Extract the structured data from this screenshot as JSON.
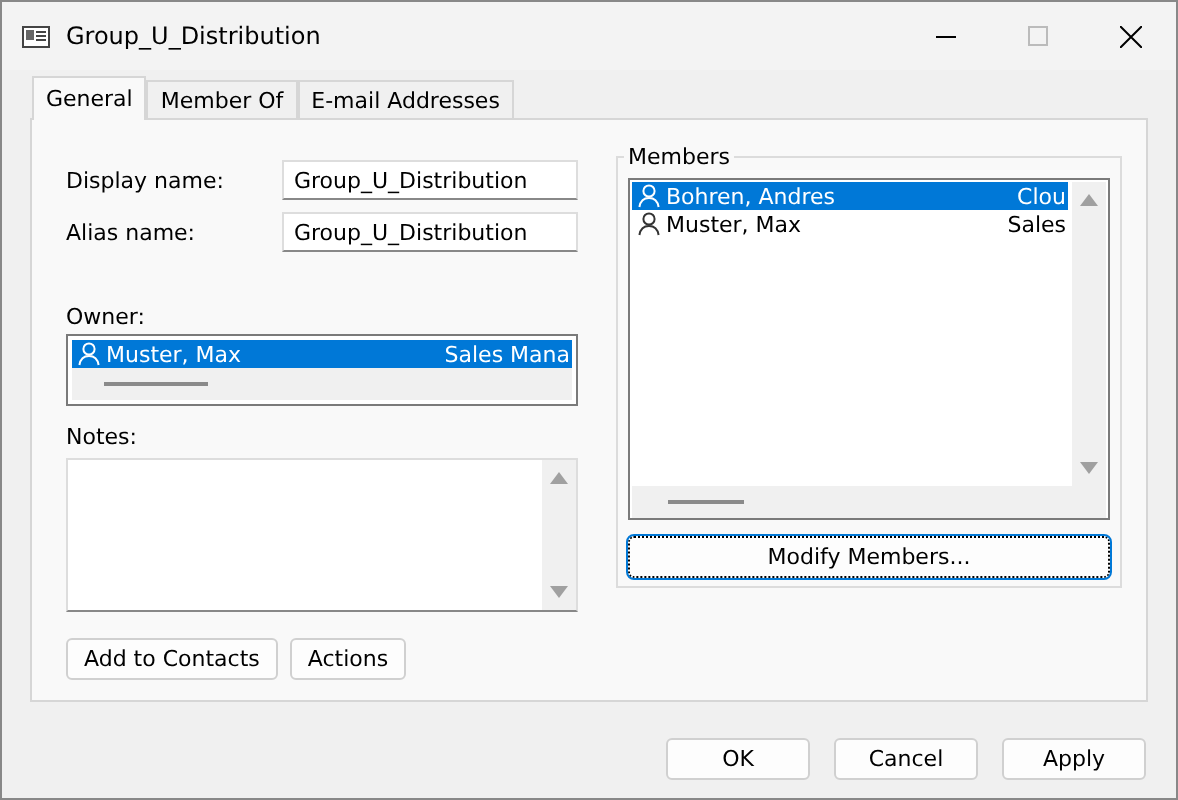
{
  "window": {
    "title": "Group_U_Distribution"
  },
  "tabs": [
    {
      "label": "General",
      "selected": true
    },
    {
      "label": "Member Of",
      "selected": false
    },
    {
      "label": "E-mail Addresses",
      "selected": false
    }
  ],
  "fields": [
    {
      "label": "Display name:",
      "value": "Group_U_Distribution"
    },
    {
      "label": "Alias name:",
      "value": "Group_U_Distribution"
    }
  ],
  "owner": {
    "label": "Owner:",
    "rows": [
      {
        "name": "Muster, Max",
        "title": "Sales Mana",
        "selected": true
      }
    ]
  },
  "notes": {
    "label": "Notes:"
  },
  "left_buttons": [
    "Add to Contacts",
    "Actions"
  ],
  "members": {
    "label": "Members",
    "rows": [
      {
        "name": "Bohren, Andres",
        "title": "Clou",
        "selected": true
      },
      {
        "name": "Muster, Max",
        "title": "Sales",
        "selected": false
      }
    ],
    "button": "Modify Members..."
  },
  "buttons": [
    "OK",
    "Cancel",
    "Apply"
  ]
}
